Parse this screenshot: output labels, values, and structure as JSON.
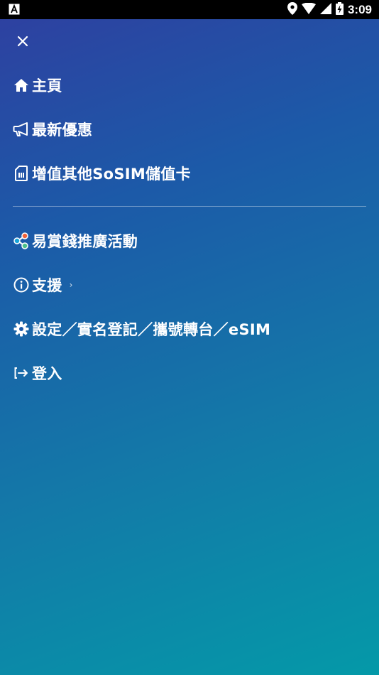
{
  "status_bar": {
    "time": "3:09"
  },
  "menu": {
    "items": [
      {
        "label": "主頁",
        "icon": "home-icon"
      },
      {
        "label": "最新優惠",
        "icon": "megaphone-icon"
      },
      {
        "label": "增值其他SoSIM儲值卡",
        "icon": "sim-card-icon"
      },
      {
        "label": "易賞錢推廣活動",
        "icon": "share-nodes-icon"
      },
      {
        "label": "支援",
        "icon": "info-circle-icon",
        "chevron": "›"
      },
      {
        "label": "設定／實名登記／攜號轉台／eSIM",
        "icon": "gear-icon"
      },
      {
        "label": "登入",
        "icon": "sign-in-icon"
      }
    ]
  },
  "colors": {
    "gradient_start": "#2f3fa0",
    "gradient_end": "#0499a8",
    "status_bar": "#000000"
  }
}
